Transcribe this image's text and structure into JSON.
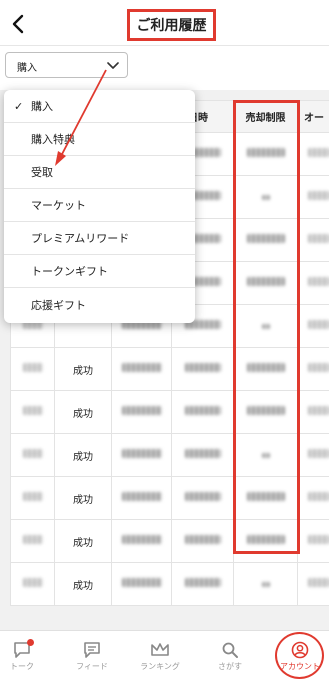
{
  "header": {
    "title": "ご利用履歴"
  },
  "filter": {
    "selected": "購入"
  },
  "dropdown": {
    "items": [
      {
        "label": "購入",
        "checked": true
      },
      {
        "label": "購入特典",
        "checked": false
      },
      {
        "label": "受取",
        "checked": false
      },
      {
        "label": "マーケット",
        "checked": false
      },
      {
        "label": "プレミアムリワード",
        "checked": false
      },
      {
        "label": "トークンギフト",
        "checked": false
      },
      {
        "label": "応援ギフト",
        "checked": false
      }
    ]
  },
  "table": {
    "headers": [
      "",
      "",
      "",
      "定日時",
      "売却制限",
      "オー"
    ],
    "status_values": [
      "",
      "",
      "",
      "",
      "",
      "成功",
      "成功",
      "成功",
      "成功",
      "成功",
      "成功"
    ]
  },
  "tabs": [
    {
      "label": "トーク",
      "icon": "chat-icon",
      "badge": true
    },
    {
      "label": "フィード",
      "icon": "feed-icon"
    },
    {
      "label": "ランキング",
      "icon": "ranking-icon"
    },
    {
      "label": "さがす",
      "icon": "search-icon"
    },
    {
      "label": "アカウント",
      "icon": "account-icon",
      "active": true
    }
  ],
  "colors": {
    "accent": "#e03a2f",
    "header_border": "#e6e6e6",
    "content_bg": "#f1f1f1"
  }
}
